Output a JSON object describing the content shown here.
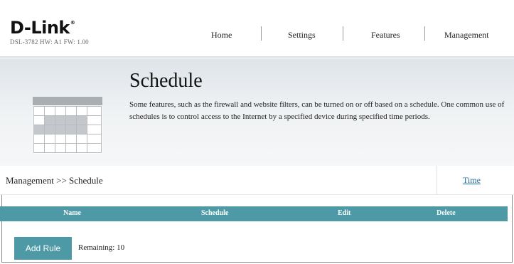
{
  "brand": {
    "logo": "D-Link",
    "registered_mark": "®",
    "model_info": "DSL-3782  HW: A1  FW: 1.00"
  },
  "nav": {
    "items": [
      {
        "label": "Home"
      },
      {
        "label": "Settings"
      },
      {
        "label": "Features"
      },
      {
        "label": "Management"
      }
    ]
  },
  "page": {
    "title": "Schedule",
    "description": "Some features, such as the firewall and website filters, can be turned on or off based on a schedule. One common use of schedules is to control access to the Internet by a specified device during specified time periods.",
    "icon": "calendar-icon"
  },
  "breadcrumb": {
    "text": "Management >> Schedule",
    "link": "Time"
  },
  "table": {
    "columns": [
      "Name",
      "Schedule",
      "Edit",
      "Delete"
    ]
  },
  "actions": {
    "add_rule_label": "Add Rule",
    "remaining_text": "Remaining: 10"
  },
  "colors": {
    "accent": "#4d9aa6",
    "link": "#1f6f9a"
  }
}
